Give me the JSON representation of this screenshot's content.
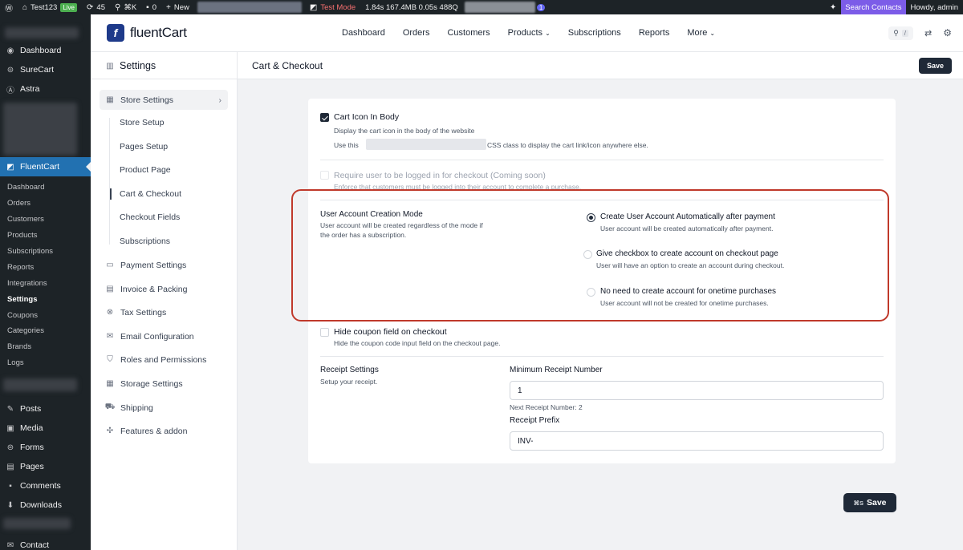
{
  "adminbar": {
    "site": "Test123",
    "live": "Live",
    "updates": "45",
    "shortcut": "⌘K",
    "comments": "0",
    "new": "New",
    "test_mode": "Test Mode",
    "perf": "1.84s  167.4MB  0.05s  488Q",
    "notif_count": "1",
    "search_contacts": "Search Contacts",
    "howdy": "Howdy, admin"
  },
  "wp_menu": {
    "top": [
      {
        "label": "Dashboard",
        "icon": "dashboard-icon"
      },
      {
        "label": "SureCart",
        "icon": "surecart-icon"
      },
      {
        "label": "Astra",
        "icon": "astra-icon"
      }
    ],
    "fluentcart": "FluentCart",
    "fluent_sub": [
      "Dashboard",
      "Orders",
      "Customers",
      "Products",
      "Subscriptions",
      "Reports",
      "Integrations",
      "Settings",
      "Coupons",
      "Categories",
      "Brands",
      "Logs"
    ],
    "bottom": [
      {
        "label": "Posts",
        "icon": "pin-icon"
      },
      {
        "label": "Media",
        "icon": "media-icon"
      },
      {
        "label": "Forms",
        "icon": "forms-icon"
      },
      {
        "label": "Pages",
        "icon": "pages-icon"
      },
      {
        "label": "Comments",
        "icon": "comments-icon"
      },
      {
        "label": "Downloads",
        "icon": "downloads-icon"
      },
      {
        "label": "Contact",
        "icon": "contact-icon"
      }
    ]
  },
  "header": {
    "logo_text": "fluentCart",
    "nav": [
      {
        "label": "Dashboard",
        "dropdown": false
      },
      {
        "label": "Orders",
        "dropdown": false
      },
      {
        "label": "Customers",
        "dropdown": false
      },
      {
        "label": "Products",
        "dropdown": true
      },
      {
        "label": "Subscriptions",
        "dropdown": false
      },
      {
        "label": "Reports",
        "dropdown": false
      },
      {
        "label": "More",
        "dropdown": true
      }
    ],
    "search_kbd": "/"
  },
  "settings_sidebar": {
    "title": "Settings",
    "store_settings": "Store Settings",
    "store_sub": [
      "Store Setup",
      "Pages Setup",
      "Product Page",
      "Cart & Checkout",
      "Checkout Fields",
      "Subscriptions"
    ],
    "items": [
      {
        "label": "Payment Settings",
        "icon": "payment-icon"
      },
      {
        "label": "Invoice & Packing",
        "icon": "invoice-icon"
      },
      {
        "label": "Tax Settings",
        "icon": "tax-icon"
      },
      {
        "label": "Email Configuration",
        "icon": "email-icon"
      },
      {
        "label": "Roles and Permissions",
        "icon": "shield-icon"
      },
      {
        "label": "Storage Settings",
        "icon": "storage-icon"
      },
      {
        "label": "Shipping",
        "icon": "shipping-icon"
      },
      {
        "label": "Features & addon",
        "icon": "puzzle-icon"
      }
    ]
  },
  "main": {
    "title": "Cart & Checkout",
    "save_top": "Save",
    "cart_icon": {
      "label": "Cart Icon In Body",
      "desc": "Display the cart icon in the body of the website",
      "use_this": "Use this",
      "use_after": "CSS class to display the cart link/icon anywhere else.",
      "checked": true
    },
    "require_login": {
      "label": "Require user to be logged in for checkout (Coming soon)",
      "desc": "Enforce that customers must be logged into their account to complete a purchase."
    },
    "account_mode": {
      "label": "User Account Creation Mode",
      "desc1": "User account will be created regardless of the mode if",
      "desc2": "the order has a subscription.",
      "options": [
        {
          "label": "Create User Account Automatically after payment",
          "desc": "User account will be created automatically after payment.",
          "selected": true
        },
        {
          "label": "Give checkbox to create account on checkout page",
          "desc": "User will have an option to create an account during checkout.",
          "selected": false
        },
        {
          "label": "No need to create account for onetime purchases",
          "desc": "User account will not be created for onetime purchases.",
          "selected": false
        }
      ]
    },
    "hide_coupon": {
      "label": "Hide coupon field on checkout",
      "desc": "Hide the coupon code input field on the checkout page.",
      "checked": false
    },
    "receipt": {
      "label": "Receipt Settings",
      "desc": "Setup your receipt.",
      "min_label": "Minimum Receipt Number",
      "min_value": "1",
      "next_note": "Next Receipt Number: 2",
      "prefix_label": "Receipt Prefix",
      "prefix_value": "INV-"
    },
    "save_bottom": "Save",
    "save_kbd": "⌘S"
  },
  "colors": {
    "wp_dark": "#1d2327",
    "wp_active": "#2271b1",
    "highlight_border": "#c0392b",
    "button_dark": "#1f2937",
    "search_contacts_bg": "#7c5ce8"
  }
}
